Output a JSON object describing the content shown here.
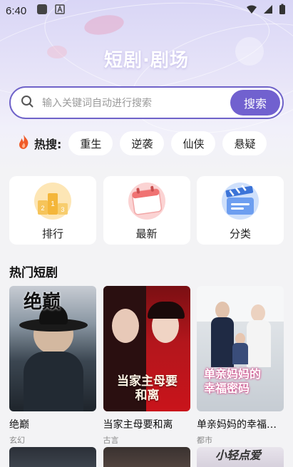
{
  "status_bar": {
    "time": "6:40"
  },
  "header": {
    "title": "短剧·剧场"
  },
  "search": {
    "placeholder": "输入关键词自动进行搜索",
    "button_label": "搜索"
  },
  "hot_search": {
    "label": "热搜:",
    "chips": [
      "重生",
      "逆袭",
      "仙侠",
      "悬疑"
    ]
  },
  "categories": [
    {
      "label": "排行",
      "icon": "podium-icon"
    },
    {
      "label": "最新",
      "icon": "calendar-icon"
    },
    {
      "label": "分类",
      "icon": "clapperboard-icon"
    }
  ],
  "section": {
    "title": "热门短剧"
  },
  "dramas": [
    {
      "name": "绝巅",
      "tag": "玄幻",
      "poster_text": "绝巅"
    },
    {
      "name": "当家主母要和离",
      "tag": "古言",
      "poster_text": "当家主母要和离"
    },
    {
      "name": "单亲妈妈的幸福密码",
      "tag": "都市",
      "poster_text": "单亲妈妈的幸福密码"
    }
  ],
  "second_row": {
    "poster_text_3": "小轻点爱"
  },
  "colors": {
    "accent": "#7161cf",
    "accent_border": "#6f63c9",
    "hot_flame": "#f05a28"
  }
}
